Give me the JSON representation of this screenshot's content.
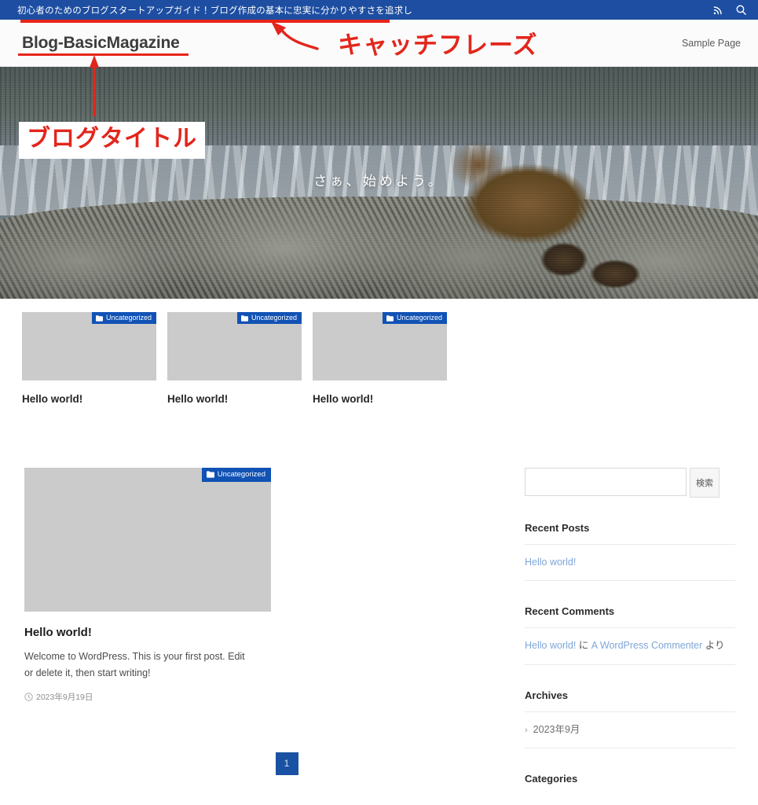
{
  "topbar": {
    "tagline": "初心者のためのブログスタートアップガイド！ブログ作成の基本に忠実に分かりやすさを追求し",
    "rss_icon": "rss-icon",
    "search_icon": "search-icon",
    "bg_color": "#1d4ea1"
  },
  "header": {
    "site_title": "Blog-BasicMagazine",
    "nav": [
      {
        "label": "Sample Page"
      }
    ]
  },
  "hero": {
    "caption": "さぁ、始めよう。",
    "image_alt": "bear-with-cubs-photo"
  },
  "cards": [
    {
      "badge": "Uncategorized",
      "badge_icon": "folder-icon",
      "title": "Hello world!"
    },
    {
      "badge": "Uncategorized",
      "badge_icon": "folder-icon",
      "title": "Hello world!"
    },
    {
      "badge": "Uncategorized",
      "badge_icon": "folder-icon",
      "title": "Hello world!"
    }
  ],
  "post": {
    "badge": "Uncategorized",
    "badge_icon": "folder-icon",
    "title": "Hello world!",
    "excerpt": "Welcome to WordPress. This is your first post. Edit or delete it, then start writing!",
    "date": "2023年9月19日",
    "date_icon": "clock-icon"
  },
  "pagination": {
    "current": "1"
  },
  "sidebar": {
    "search": {
      "value": "",
      "placeholder": "",
      "button_label": "検索"
    },
    "recent_posts": {
      "title": "Recent Posts",
      "items": [
        {
          "label": "Hello world!"
        }
      ]
    },
    "recent_comments": {
      "title": "Recent Comments",
      "items": [
        {
          "post": "Hello world!",
          "sep": " に ",
          "author": "A WordPress Commenter",
          "suffix": " より"
        }
      ]
    },
    "archives": {
      "title": "Archives",
      "items": [
        {
          "label": "2023年9月",
          "icon": "chevron-right-icon"
        }
      ]
    },
    "categories": {
      "title": "Categories"
    }
  },
  "annotations": {
    "catch_phrase": "キャッチフレーズ",
    "blog_title": "ブログタイトル",
    "color": "#e2261c"
  },
  "colors": {
    "primary_blue": "#1d4ea1",
    "badge_blue": "#1152b5",
    "link_blue": "#7fa6d8",
    "annotation_red": "#e2261c",
    "thumb_gray": "#cbcbcb"
  }
}
